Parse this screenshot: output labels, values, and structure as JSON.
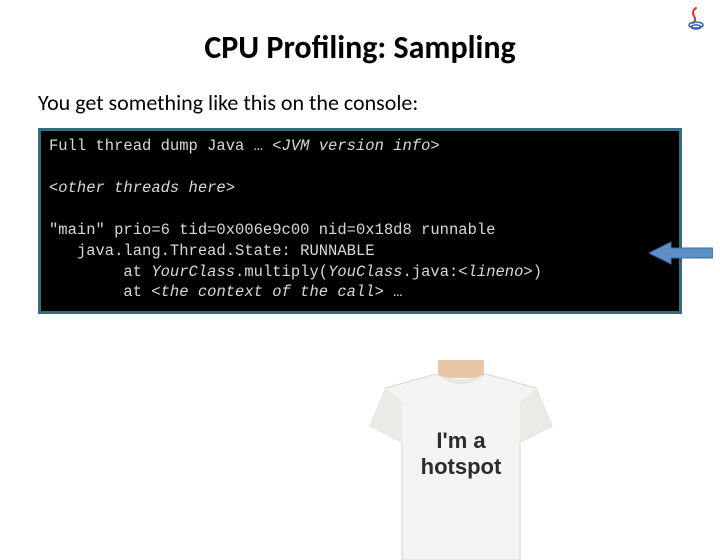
{
  "slide": {
    "title": "CPU Profiling: Sampling",
    "subtitle": "You get something like this on the console:",
    "console": {
      "prefix_line1": "Full thread dump Java … ",
      "italic_line1": "<JVM version info>",
      "blank1": "",
      "italic_line2": "<other threads here>",
      "blank2": "",
      "line3": "\"main\" prio=6 tid=0x006e9c00 nid=0x18d8 runnable",
      "line4": "   java.lang.Thread.State: RUNNABLE",
      "line5_pre": "        at ",
      "line5_cls": "YourClass",
      "line5_mid": ".multiply(",
      "line5_cls2": "YouClass",
      "line5_post1": ".java:",
      "line5_lineno": "<lineno>",
      "line5_end": ")",
      "line6_pre": "        at ",
      "line6_ctx": "<the context of the call>",
      "line6_end": " …"
    },
    "tshirt_text_line1": "I'm a",
    "tshirt_text_line2": "hotspot",
    "logo_name": "java-duke-icon"
  }
}
